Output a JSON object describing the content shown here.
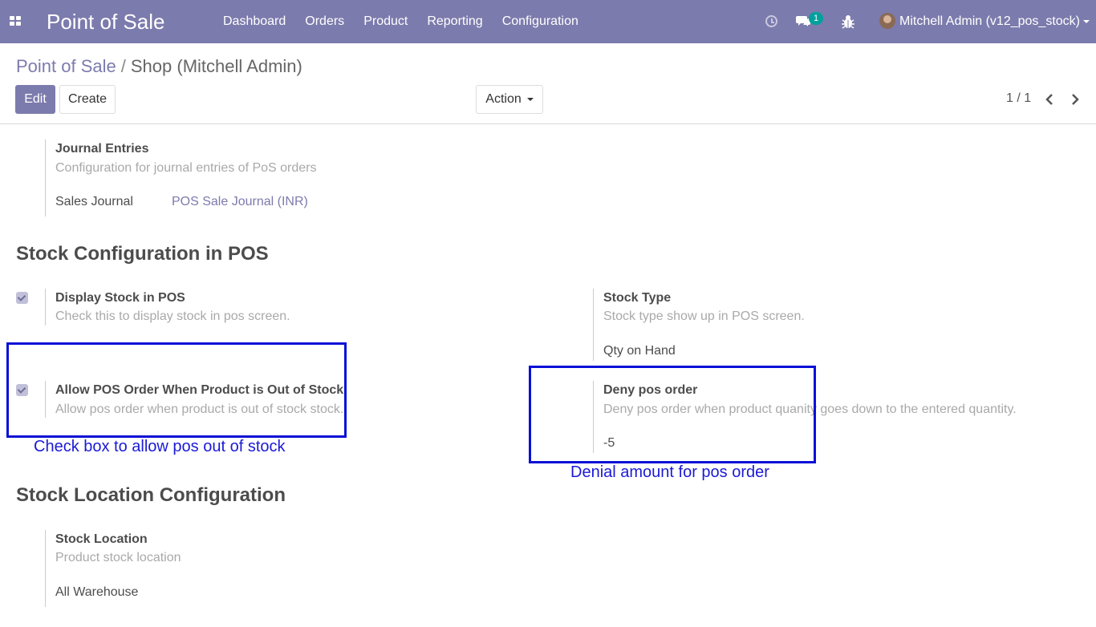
{
  "navbar": {
    "app_title": "Point of Sale",
    "menu": [
      "Dashboard",
      "Orders",
      "Product",
      "Reporting",
      "Configuration"
    ],
    "chat_count": "1",
    "user": "Mitchell Admin (v12_pos_stock)",
    "accent_color": "#7c7bad"
  },
  "breadcrumb": {
    "parent": "Point of Sale",
    "separator": "/",
    "current": "Shop (Mitchell Admin)"
  },
  "buttons": {
    "edit": "Edit",
    "create": "Create",
    "action": "Action"
  },
  "pager": {
    "text": "1 / 1"
  },
  "journal": {
    "title": "Journal Entries",
    "help": "Configuration for journal entries of PoS orders",
    "field_label": "Sales Journal",
    "field_value": "POS Sale Journal (INR)"
  },
  "stock_section": {
    "title": "Stock Configuration in POS",
    "display_stock": {
      "label": "Display Stock in POS",
      "help": "Check this to display stock in pos screen.",
      "checked": true
    },
    "stock_type": {
      "label": "Stock Type",
      "help": "Stock type show up in POS screen.",
      "value": "Qty on Hand"
    },
    "allow_out_of_stock": {
      "label": "Allow POS Order When Product is Out of Stock",
      "help": "Allow pos order when product is out of stock stock.",
      "checked": true
    },
    "deny_order": {
      "label": "Deny pos order",
      "help": "Deny pos order when product quanity goes down to the entered quantity.",
      "value": "-5"
    }
  },
  "location_section": {
    "title": "Stock Location Configuration",
    "label": "Stock Location",
    "help": "Product stock location",
    "value": "All Warehouse"
  },
  "annotations": {
    "checkbox_note": "Check box to allow pos out of stock",
    "deny_note": "Denial amount for pos order",
    "color": "#0a10d6"
  }
}
